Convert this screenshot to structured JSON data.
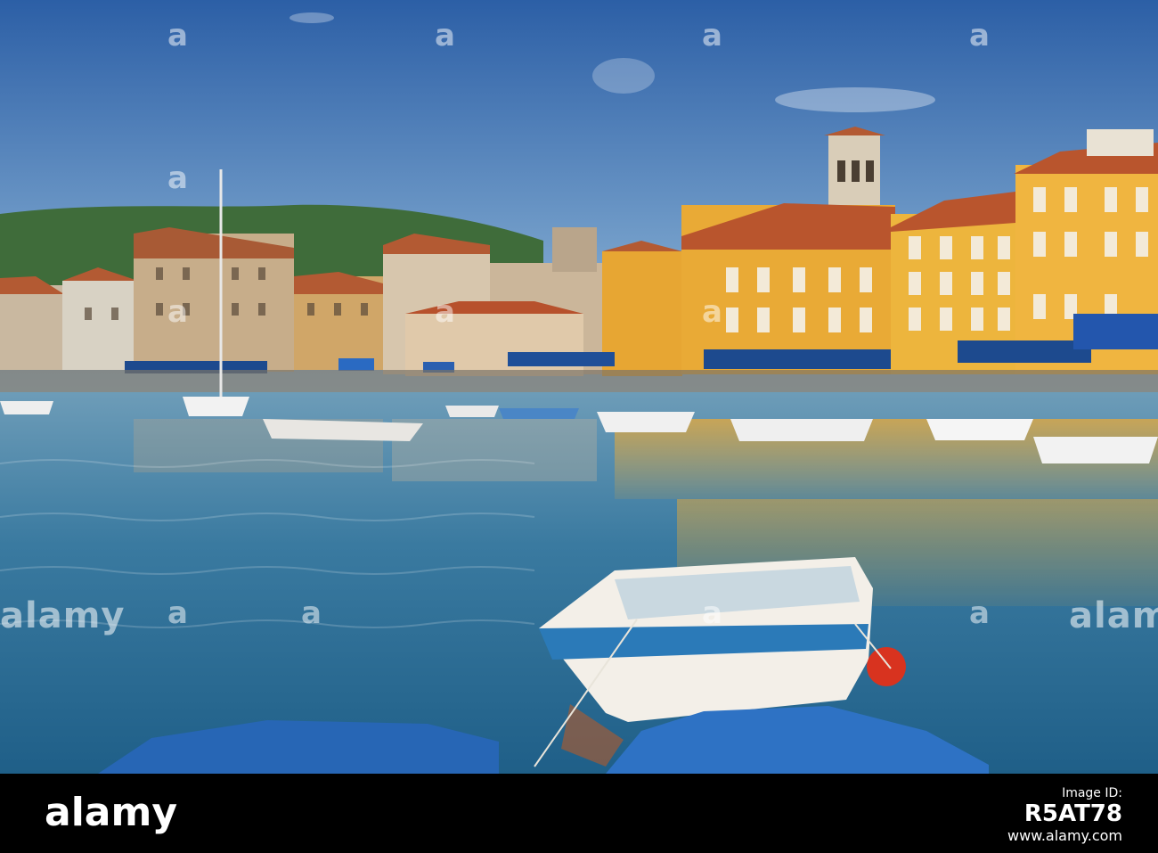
{
  "photo": {
    "subject": "harbour-town-waterfront",
    "colors": {
      "sky_top": "#2f63a8",
      "sky_bottom": "#8eb8d8",
      "hill": "#3e6b3a",
      "water": "#3f7ea3",
      "building_yellow": "#e8a935",
      "building_beige": "#cdb79a",
      "roof": "#b5552e",
      "awning": "#1d4e9a"
    }
  },
  "watermark": {
    "text": "alamy",
    "letter": "a"
  },
  "footer": {
    "logo": "alamy",
    "image_id_label": "Image ID:",
    "image_id": "R5AT78",
    "site": "www.alamy.com"
  }
}
